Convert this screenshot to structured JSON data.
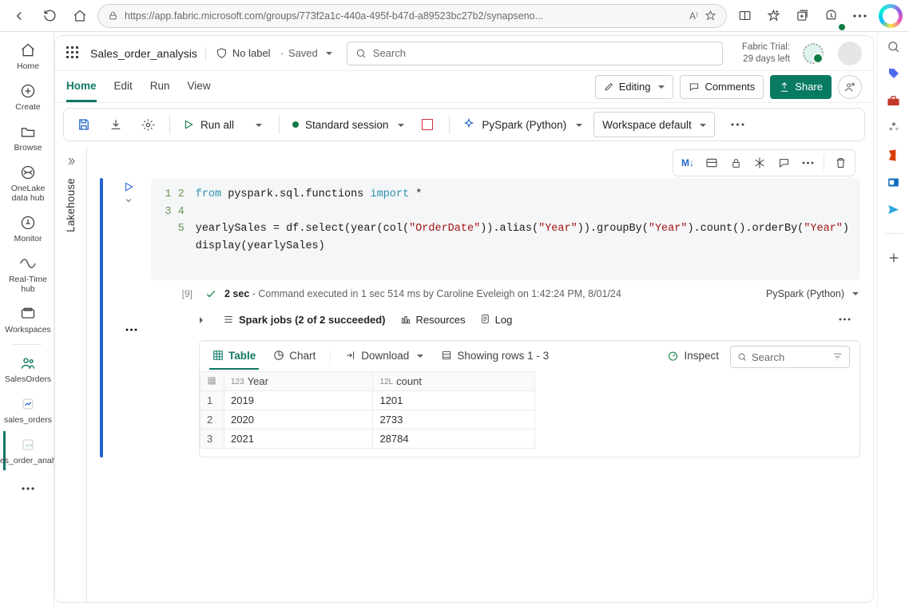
{
  "browser": {
    "url": "https://app.fabric.microsoft.com/groups/773f2a1c-440a-495f-b47d-a89523bc27b2/synapseno..."
  },
  "topbar": {
    "filename": "Sales_order_analysis",
    "sensitivity": "No label",
    "save_status": "Saved",
    "search_placeholder": "Search",
    "trial_line1": "Fabric Trial:",
    "trial_line2": "29 days left"
  },
  "tabs": {
    "items": [
      "Home",
      "Edit",
      "Run",
      "View"
    ],
    "editing": "Editing",
    "comments": "Comments",
    "share": "Share"
  },
  "toolbar": {
    "run_all": "Run all",
    "session": "Standard session",
    "kernel": "PySpark (Python)",
    "env": "Workspace default"
  },
  "left_rail": {
    "items": [
      {
        "label": "Home"
      },
      {
        "label": "Create"
      },
      {
        "label": "Browse"
      },
      {
        "label": "OneLake data hub"
      },
      {
        "label": "Monitor"
      },
      {
        "label": "Real-Time hub"
      },
      {
        "label": "Workspaces"
      },
      {
        "label": "SalesOrders"
      },
      {
        "label": "sales_orders"
      },
      {
        "label": "Sales_order_analysis"
      }
    ]
  },
  "lakehouse_label": "Lakehouse",
  "cell": {
    "toolbar_md": "M↓",
    "lines": [
      "1",
      "2",
      "3",
      "4",
      "5"
    ],
    "code_tokens": [
      [
        {
          "t": "from ",
          "c": "kw"
        },
        {
          "t": "pyspark.sql.functions ",
          "c": ""
        },
        {
          "t": "import ",
          "c": "kw"
        },
        {
          "t": "*",
          "c": ""
        }
      ],
      [
        {
          "t": "",
          "c": ""
        }
      ],
      [
        {
          "t": "yearlySales = df.select(year(col(",
          "c": ""
        },
        {
          "t": "\"OrderDate\"",
          "c": "str"
        },
        {
          "t": ")).alias(",
          "c": ""
        },
        {
          "t": "\"Year\"",
          "c": "str"
        },
        {
          "t": ")).groupBy(",
          "c": ""
        },
        {
          "t": "\"Year\"",
          "c": "str"
        },
        {
          "t": ").count().orderBy(",
          "c": ""
        },
        {
          "t": "\"Year\"",
          "c": "str"
        },
        {
          "t": ")",
          "c": ""
        }
      ],
      [
        {
          "t": "display(yearlySales)",
          "c": ""
        }
      ],
      [
        {
          "t": "",
          "c": ""
        }
      ]
    ],
    "exec_index": "[9]",
    "exec_time": "2 sec",
    "exec_msg": "- Command executed in 1 sec 514 ms by Caroline Eveleigh on 1:42:24 PM, 8/01/24",
    "exec_kernel": "PySpark (Python)"
  },
  "output": {
    "spark_jobs": "Spark jobs (2 of 2 succeeded)",
    "resources": "Resources",
    "log": "Log",
    "table_tab": "Table",
    "chart_tab": "Chart",
    "download": "Download",
    "rows_info": "Showing rows 1 - 3",
    "inspect": "Inspect",
    "search_placeholder": "Search",
    "columns": [
      "Year",
      "count"
    ],
    "col_types": [
      "123",
      "12L"
    ],
    "rows": [
      {
        "idx": "1",
        "year": "2019",
        "count": "1201"
      },
      {
        "idx": "2",
        "year": "2020",
        "count": "2733"
      },
      {
        "idx": "3",
        "year": "2021",
        "count": "28784"
      }
    ]
  },
  "chart_data": {
    "type": "table",
    "title": "yearlySales",
    "columns": [
      "Year",
      "count"
    ],
    "rows": [
      [
        "2019",
        1201
      ],
      [
        "2020",
        2733
      ],
      [
        "2021",
        28784
      ]
    ]
  }
}
